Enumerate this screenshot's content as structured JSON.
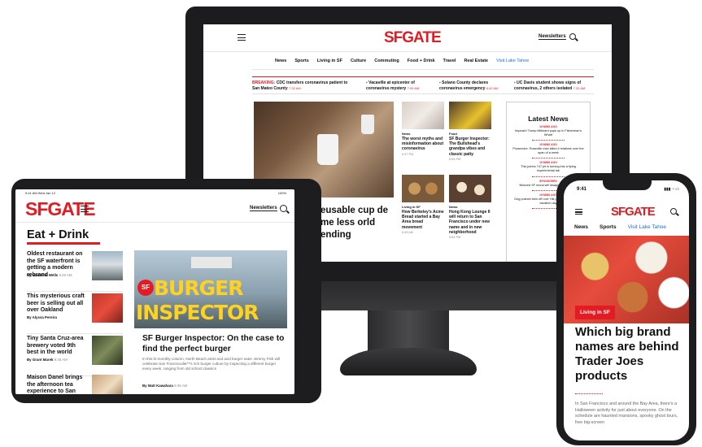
{
  "brand": {
    "logo": "SFGATE",
    "accent": "#e31b23",
    "link": "#1a6fd6"
  },
  "monitor": {
    "newsletters": "Newsletters",
    "nav": [
      "News",
      "Sports",
      "Living in SF",
      "Culture",
      "Commuting",
      "Food + Drink",
      "Travel",
      "Real Estate",
      "Visit Lake Tahoe"
    ],
    "breaking": [
      {
        "label": "BREAKING:",
        "text": "CDC transfers coronavirus patient to San Mateo County",
        "time": "7:32 AM"
      },
      {
        "text": "Vacaville at epicenter of coronavirus mystery",
        "time": "7:09 AM"
      },
      {
        "text": "Solano County declares coronavirus emergency",
        "time": "6:42 AM"
      },
      {
        "text": "UC Davis student shows signs of coronavirus, 2 others isolated",
        "time": "7:32 AM"
      }
    ],
    "hero_title": "eusable cup de me less orld ending",
    "stories": [
      {
        "cat": "News",
        "headline": "The worst myths and misinformation about coronavirus",
        "time": "6:37 PM"
      },
      {
        "cat": "Food",
        "headline": "SF Burger Inspector: The Bullshead's grandpa vibes and classic patty",
        "time": "6:53 PM"
      },
      {
        "cat": "Living in SF",
        "headline": "How Berkeley’s Acme Bread started a Bay Area bread movement",
        "time": "6:45 AM"
      },
      {
        "cat": "News",
        "headline": "Hong Kong Lounge II will return to San Francisco under new name and in new neighborhood",
        "time": "5:52 PM"
      }
    ],
    "latest": {
      "title": "Latest News",
      "items": [
        {
          "time": "15 MINS AGO",
          "text": "Impeach Trump billboard pops up in Fisherman's Wharf"
        },
        {
          "time": "15 MINS AGO",
          "text": "Prosecutor: Roseville man killed 4 relatives over the span of a week"
        },
        {
          "time": "15 MINS AGO",
          "text": "This jumbo 747 jet is turning into a flying experimental lab"
        },
        {
          "time": "SPONSORED",
          "text": "Beloved SF mural will disappear this week"
        },
        {
          "time": "15 MINS AGO",
          "text": "Dog pushes teen off roof: His punishment: Love a vacation day"
        }
      ]
    }
  },
  "tablet": {
    "status_time": "9:41 AM  Wed Jan 12",
    "status_right": "100%",
    "newsletters": "Newsletters",
    "section": "Eat + Drink",
    "stories": [
      {
        "headline": "Oldest restaurant on the SF waterfront is getting a modern rebrand",
        "by": "By Madeline Wells",
        "time": "9:45 AM"
      },
      {
        "headline": "This mysterious craft beer is selling out all over Oakland",
        "by": "By Alyssa Pereira",
        "time": ""
      },
      {
        "headline": "Tiny Santa Cruz-area brewery voted 9th best in the world",
        "by": "By Grant Marek",
        "time": "9:45 AM"
      },
      {
        "headline": "Maison Danel brings the afternoon tea experience to San",
        "by": "",
        "time": ""
      }
    ],
    "feature": {
      "image_text_1": "BURGER",
      "image_text_2": "INSPECTOR",
      "badge": "SF",
      "title": "SF Burger Inspector: On the case to find the perfect burger",
      "desc": "In this bi-monthly column, North Beach artist and avid burger eater Jeremy Fish will celebrate San Franciscoâ€™s rich burger culture by inspecting a different burger every week, ranging from old school classics",
      "by": "By Matt Kawahara",
      "time": "9:45 AM"
    }
  },
  "phone": {
    "time": "9:41",
    "nav": [
      "News",
      "Sports",
      "Visit Lake Tahoe"
    ],
    "badge": "Living in SF",
    "title": "Which big brand names are behind Trader Joes products",
    "desc": "In San Francisco and around the Bay Area, there's a Halloween activity for just about everyone. On the schedule are haunted mansions, spooky ghost tours, free big-screen"
  }
}
